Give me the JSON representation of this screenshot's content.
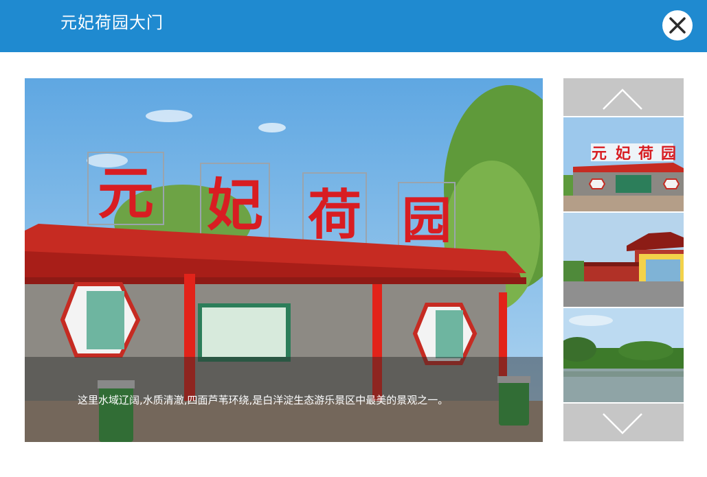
{
  "dialog": {
    "title": "元妃荷园大门"
  },
  "photo": {
    "sign_characters": [
      "元",
      "妃",
      "荷",
      "园"
    ],
    "caption": "这里水域辽阔,水质清澈,四面芦苇环绕,是白洋淀生态游乐景区中最美的景观之一。"
  },
  "thumbnails": {
    "items": [
      {
        "subject": "garden-gate"
      },
      {
        "subject": "pavilion"
      },
      {
        "subject": "lake"
      }
    ]
  },
  "colors": {
    "header": "#1f8ad0",
    "nav_button": "#c6c6c6",
    "caption_overlay": "rgba(40,40,40,0.45)"
  },
  "icons": {
    "close": "close-icon",
    "up": "chevron-up-icon",
    "down": "chevron-down-icon"
  }
}
